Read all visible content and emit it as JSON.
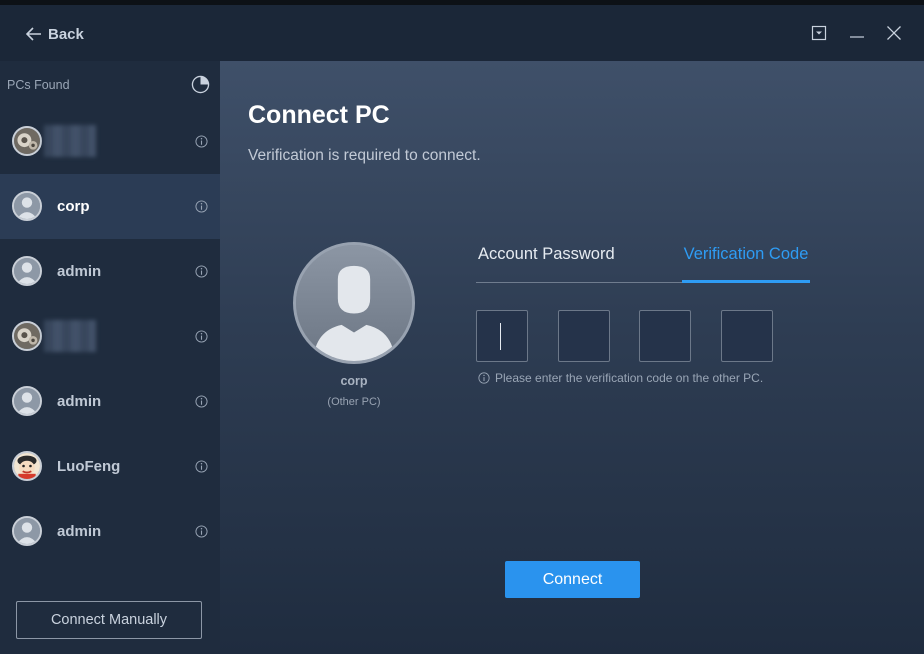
{
  "titlebar": {
    "back_label": "Back",
    "controls": [
      "dropdown-icon",
      "minimize-icon",
      "close-icon"
    ]
  },
  "sidebar": {
    "header": "PCs Found",
    "items": [
      {
        "name": "",
        "avatar": "gear-avatar",
        "blurred": true
      },
      {
        "name": "corp",
        "avatar": "user-avatar",
        "selected": true
      },
      {
        "name": "admin",
        "avatar": "user-avatar"
      },
      {
        "name": "",
        "avatar": "gear-avatar",
        "blurred": true
      },
      {
        "name": "admin",
        "avatar": "user-avatar"
      },
      {
        "name": "LuoFeng",
        "avatar": "cartoon-avatar"
      },
      {
        "name": "admin",
        "avatar": "user-avatar"
      }
    ],
    "connect_manually_label": "Connect Manually"
  },
  "main": {
    "title": "Connect PC",
    "subtitle": "Verification is required to connect.",
    "target": {
      "name": "corp",
      "sub": "(Other PC)"
    },
    "tabs": [
      {
        "label": "Account Password",
        "active": false
      },
      {
        "label": "Verification Code",
        "active": true
      }
    ],
    "code_boxes": [
      "",
      "",
      "",
      ""
    ],
    "hint": "Please enter the verification code on the other PC.",
    "connect_label": "Connect"
  },
  "colors": {
    "accent": "#2a93ee",
    "sidebar_bg": "#1f2c3e",
    "selected_bg": "#2b3c55",
    "titlebar_bg": "#1b2738"
  }
}
